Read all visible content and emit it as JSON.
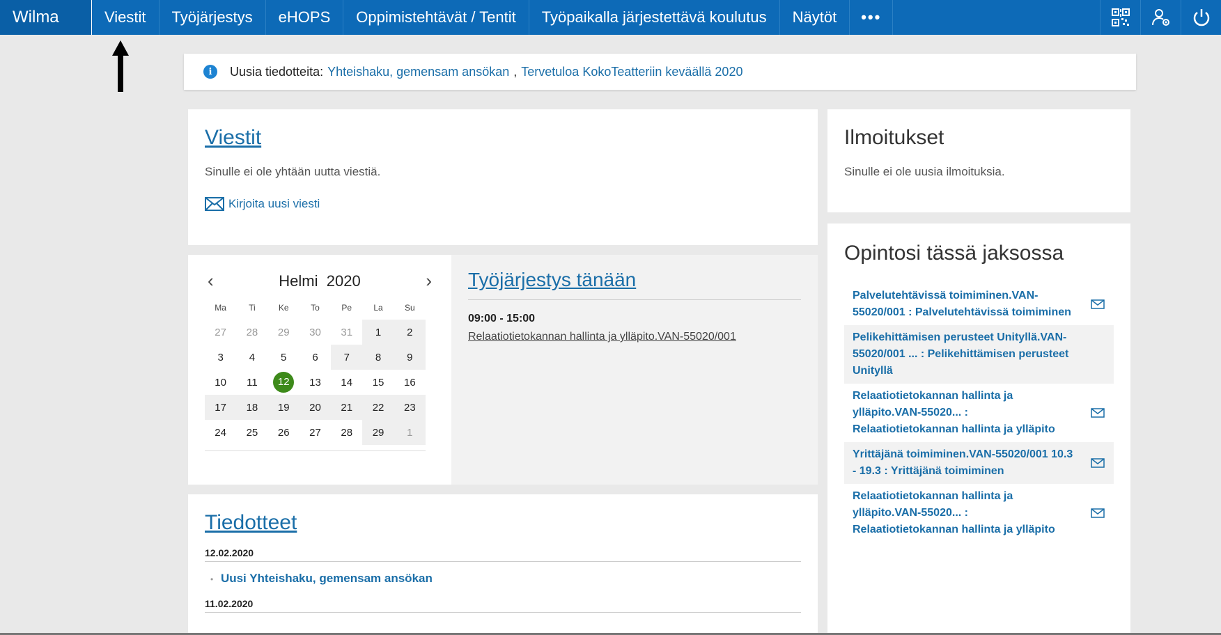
{
  "nav": {
    "brand": "Wilma",
    "items": [
      "Viestit",
      "Työjärjestys",
      "eHOPS",
      "Oppimistehtävät / Tentit",
      "Työpaikalla järjestettävä koulutus",
      "Näytöt"
    ],
    "more": "•••"
  },
  "notice": {
    "label": "Uusia tiedotteita:",
    "link1": "Yhteishaku, gemensam ansökan",
    "sep": ",",
    "link2": "Tervetuloa KokoTeatteriin keväällä 2020"
  },
  "messages": {
    "title": "Viestit",
    "empty": "Sinulle ei ole yhtään uutta viestiä.",
    "compose": "Kirjoita uusi viesti"
  },
  "calendar": {
    "month": "Helmi",
    "year": "2020",
    "weekdays": [
      "Ma",
      "Ti",
      "Ke",
      "To",
      "Pe",
      "La",
      "Su"
    ],
    "weeks": [
      [
        "27",
        "28",
        "29",
        "30",
        "31",
        "1",
        "2"
      ],
      [
        "3",
        "4",
        "5",
        "6",
        "7",
        "8",
        "9"
      ],
      [
        "10",
        "11",
        "12",
        "13",
        "14",
        "15",
        "16"
      ],
      [
        "17",
        "18",
        "19",
        "20",
        "21",
        "22",
        "23"
      ],
      [
        "24",
        "25",
        "26",
        "27",
        "28",
        "29",
        "1"
      ]
    ],
    "today": "12"
  },
  "schedule": {
    "title": "Työjärjestys tänään",
    "time": "09:00 - 15:00",
    "course": "Relaatiotietokannan hallinta ja ylläpito.VAN-55020/001"
  },
  "bulletins": {
    "title": "Tiedotteet",
    "entries": [
      {
        "date": "12.02.2020",
        "prefix": "Uusi",
        "link": "Yhteishaku, gemensam ansökan"
      },
      {
        "date": "11.02.2020"
      }
    ]
  },
  "notifications": {
    "title": "Ilmoitukset",
    "empty": "Sinulle ei ole uusia ilmoituksia."
  },
  "studies": {
    "title": "Opintosi tässä jaksossa",
    "items": [
      {
        "text": "Palvelutehtävissä toimiminen.VAN-55020/001 : Palvelutehtävissä toimiminen",
        "mail": true
      },
      {
        "text": "Pelikehittämisen perusteet Unityllä.VAN-55020/001 ... : Pelikehittämisen perusteet Unityllä",
        "mail": false
      },
      {
        "text": "Relaatiotietokannan hallinta ja ylläpito.VAN-55020... : Relaatiotietokannan hallinta ja ylläpito",
        "mail": true
      },
      {
        "text": "Yrittäjänä toimiminen.VAN-55020/001 10.3 - 19.3 : Yrittäjänä toimiminen",
        "mail": true
      },
      {
        "text": "Relaatiotietokannan hallinta ja ylläpito.VAN-55020... : Relaatiotietokannan hallinta ja ylläpito",
        "mail": true
      }
    ]
  },
  "colors": {
    "navbar": "#0d6ab7",
    "link": "#1a6ea8",
    "today": "#3d8a1a"
  },
  "icons": {
    "qr": "qr-code-icon",
    "user_settings": "user-settings-icon",
    "logout": "power-icon",
    "info": "info-icon",
    "mail": "mail-icon"
  }
}
